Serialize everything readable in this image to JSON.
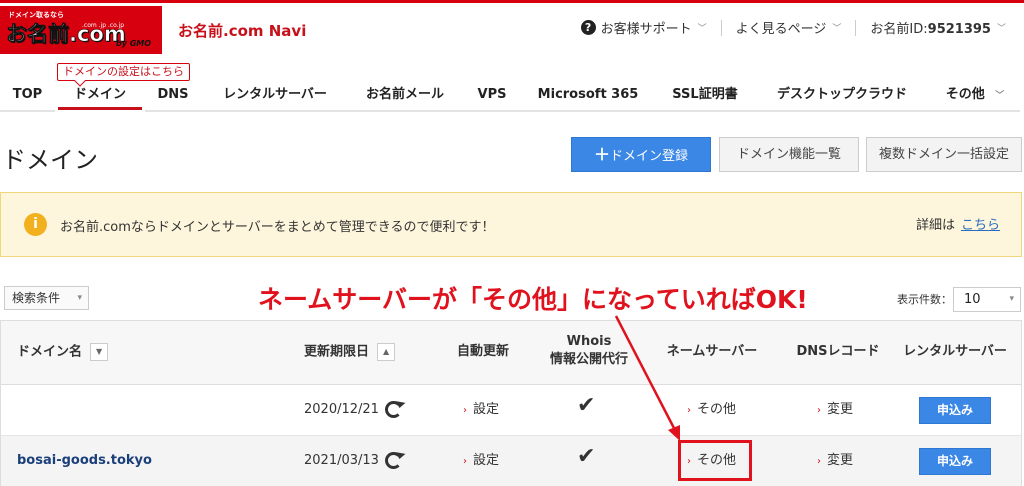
{
  "header": {
    "logo_tagline": "ドメイン取るなら",
    "logo_brand": "お名前.com",
    "logo_tld": ".com .jp .co.jp",
    "logo_gmo": "by GMO",
    "navi_title": "お名前.com Navi",
    "support_label": "お客様サポート",
    "faq_label": "よく見るページ",
    "user_id_label": "お名前ID:",
    "user_id": "9521395"
  },
  "tooltip": "ドメインの設定はこちら",
  "nav": {
    "items": [
      {
        "label": "TOP"
      },
      {
        "label": "ドメイン"
      },
      {
        "label": "DNS"
      },
      {
        "label": "レンタルサーバー"
      },
      {
        "label": "お名前メール"
      },
      {
        "label": "VPS"
      },
      {
        "label": "Microsoft 365"
      },
      {
        "label": "SSL証明書"
      },
      {
        "label": "デスクトップクラウド"
      },
      {
        "label": "その他"
      }
    ]
  },
  "page": {
    "title": "ドメイン",
    "register_button": "ドメイン登録",
    "features_button": "ドメイン機能一覧",
    "bulk_button": "複数ドメイン一括設定"
  },
  "notice": {
    "message": "お名前.comならドメインとサーバーをまとめて管理できるので便利です！",
    "detail_prefix": "詳細は",
    "detail_link": "こちら"
  },
  "filters": {
    "search_condition": "検索条件",
    "per_page_label": "表示件数：",
    "per_page_value": "10"
  },
  "table": {
    "headers": {
      "domain": "ドメイン名",
      "expiry": "更新期限日",
      "auto_renew": "自動更新",
      "whois_line1": "Whois",
      "whois_line2": "情報公開代行",
      "nameserver": "ネームサーバー",
      "dns": "DNSレコード",
      "server": "レンタルサーバー"
    },
    "rows": [
      {
        "domain": "",
        "expiry": "2020/12/21",
        "auto_renew": "設定",
        "whois": "✔",
        "nameserver": "その他",
        "dns": "変更",
        "server": "申込み"
      },
      {
        "domain": "bosai-goods.tokyo",
        "expiry": "2021/03/13",
        "auto_renew": "設定",
        "whois": "✔",
        "nameserver": "その他",
        "dns": "変更",
        "server": "申込み"
      }
    ]
  },
  "annotation": {
    "callout": "ネームサーバーが「その他」になっていればOK!",
    "color": "#e0121d"
  },
  "colors": {
    "brand_red": "#d7000f",
    "primary_blue": "#3a87e5",
    "notice_bg": "#fdf6dc"
  }
}
